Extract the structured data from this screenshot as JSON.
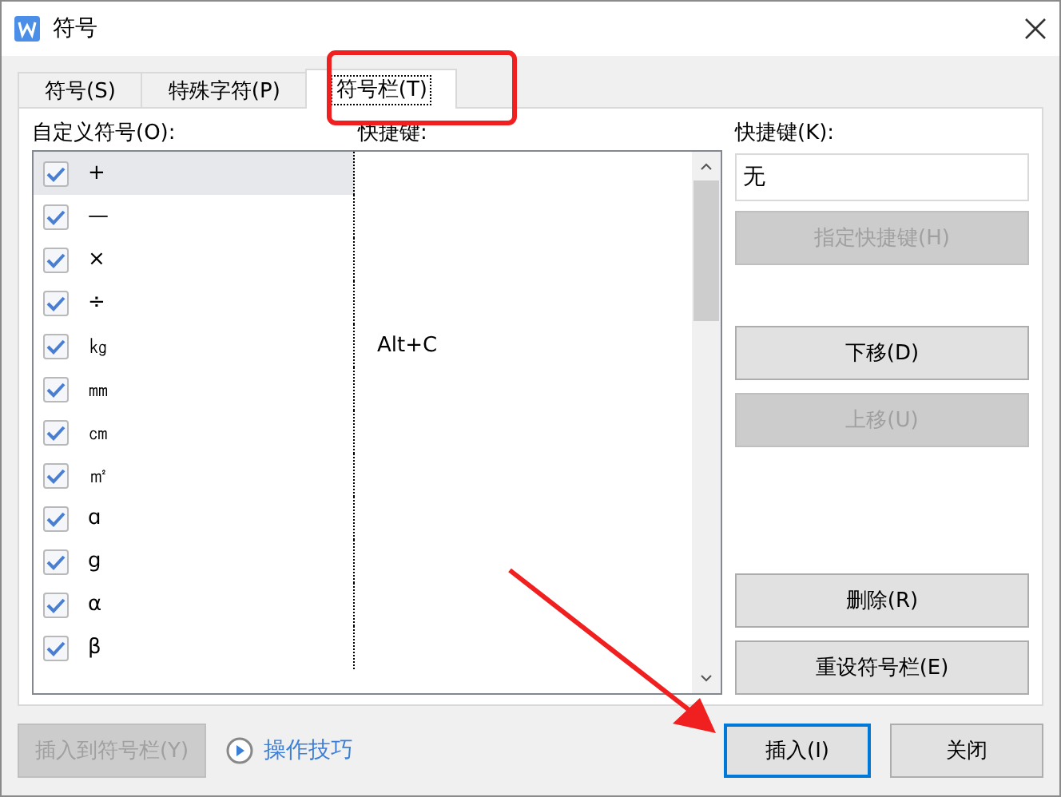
{
  "window": {
    "title": "符号"
  },
  "tabs": [
    {
      "label": "符号(S)",
      "selected": false
    },
    {
      "label": "特殊字符(P)",
      "selected": false
    },
    {
      "label": "符号栏(T)",
      "selected": true
    }
  ],
  "list": {
    "label": "自定义符号(O):",
    "shortcut_heading": "快捷键:",
    "rows": [
      {
        "symbol": "+",
        "checked": true,
        "selected": true
      },
      {
        "symbol": "—",
        "checked": true,
        "selected": false
      },
      {
        "symbol": "×",
        "checked": true,
        "selected": false
      },
      {
        "symbol": "÷",
        "checked": true,
        "selected": false
      },
      {
        "symbol": "㎏",
        "checked": true,
        "selected": false,
        "shortcut": "Alt+C"
      },
      {
        "symbol": "㎜",
        "checked": true,
        "selected": false
      },
      {
        "symbol": "㎝",
        "checked": true,
        "selected": false
      },
      {
        "symbol": "㎡",
        "checked": true,
        "selected": false
      },
      {
        "symbol": "ɑ",
        "checked": true,
        "selected": false
      },
      {
        "symbol": "g",
        "checked": true,
        "selected": false
      },
      {
        "symbol": "α",
        "checked": true,
        "selected": false
      },
      {
        "symbol": "β",
        "checked": true,
        "selected": false
      }
    ]
  },
  "shortcut_field": {
    "label": "快捷键(K):",
    "value": "无"
  },
  "side_button_groups": [
    [
      {
        "label": "指定快捷键(H)",
        "disabled": true
      }
    ],
    [
      {
        "label": "下移(D)",
        "disabled": false
      },
      {
        "label": "上移(U)",
        "disabled": true
      }
    ],
    [
      {
        "label": "删除(R)",
        "disabled": false
      },
      {
        "label": "重设符号栏(E)",
        "disabled": false
      }
    ]
  ],
  "footer": {
    "add_button": {
      "label": "插入到符号栏(Y)",
      "disabled": true
    },
    "tips_link": "操作技巧",
    "insert_button": {
      "label": "插入(I)",
      "disabled": false
    },
    "close_button": {
      "label": "关闭",
      "disabled": false
    }
  }
}
